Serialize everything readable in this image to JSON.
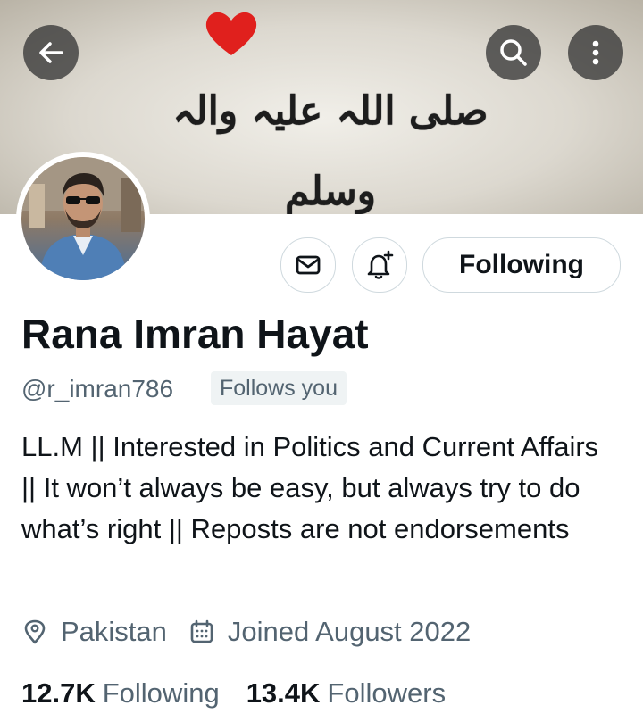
{
  "banner": {
    "calligraphy_text": "صلی اللہ علیہ والہ وسلم",
    "heart_color": "#e0201d"
  },
  "toolbar": {
    "back_icon": "arrow-left-icon",
    "search_icon": "search-icon",
    "more_icon": "more-vertical-icon"
  },
  "profile": {
    "avatar_icon": "profile-photo",
    "name": "Rana Imran Hayat",
    "handle": "@r_imran786",
    "follows_you": "Follows you",
    "bio": "LL.M || Interested in Politics and Current Affairs || It won’t always be easy, but always try to do what’s right || Reposts are not endorsements",
    "location": "Pakistan",
    "joined": "Joined August 2022",
    "following_count": "12.7K",
    "following_label": "Following",
    "followers_count": "13.4K",
    "followers_label": "Followers"
  },
  "actions": {
    "message_icon": "envelope-icon",
    "notify_icon": "bell-plus-icon",
    "follow_label": "Following"
  },
  "colors": {
    "text_primary": "#0f1419",
    "text_secondary": "#536471",
    "border": "#cfd9de"
  }
}
